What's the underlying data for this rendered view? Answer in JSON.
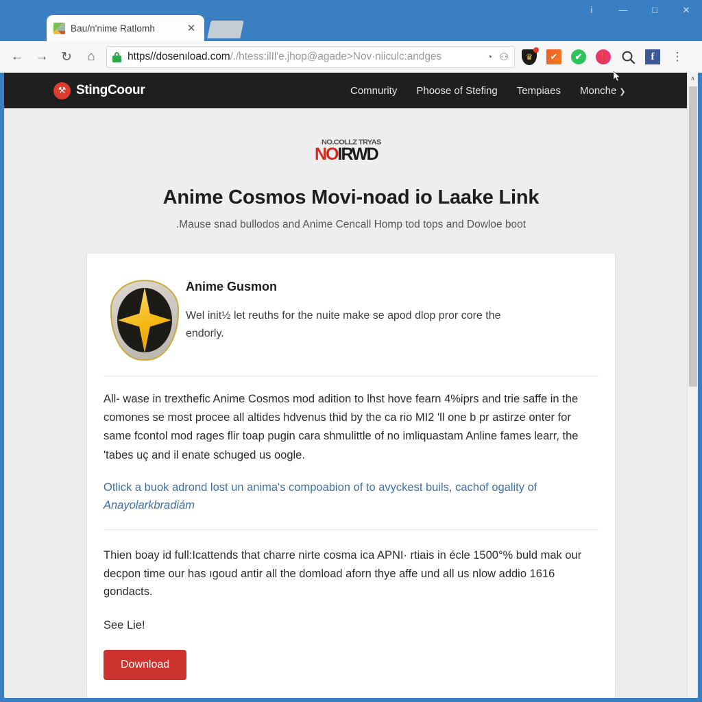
{
  "window": {
    "controls": [
      {
        "name": "info",
        "glyph": "i"
      },
      {
        "name": "minimize",
        "glyph": "—"
      },
      {
        "name": "maximize",
        "glyph": "□"
      },
      {
        "name": "close",
        "glyph": "✕"
      }
    ]
  },
  "tab": {
    "title": "Bau/n'nime Ratlomh",
    "close_glyph": "✕"
  },
  "toolbar": {
    "back_glyph": "←",
    "forward_glyph": "→",
    "reload_glyph": "↻",
    "home_glyph": "⌂",
    "url_host": "https//dosenıload.com",
    "url_path": "/./htess:ilIl'e.jhop@agade>Nov·niiculc:andges",
    "omni_icon_1": "◔",
    "omni_icon_2": "⚇",
    "menu_glyph": "⋮",
    "extensions": [
      {
        "name": "shield-extension",
        "glyph": "♛"
      },
      {
        "name": "orange-extension",
        "glyph": "✔"
      },
      {
        "name": "green-check-extension",
        "glyph": "✔"
      },
      {
        "name": "pink-extension",
        "glyph": "❗"
      },
      {
        "name": "search-extension",
        "glyph": "⌕"
      },
      {
        "name": "facebook-extension",
        "glyph": "f"
      }
    ]
  },
  "site": {
    "brand": "StingCoour",
    "brand_mark_glyph": "⚒",
    "nav": [
      {
        "label": "Comnurity"
      },
      {
        "label": "Phoose of Stefing"
      },
      {
        "label": "Tempiaes"
      },
      {
        "label": "Monche"
      }
    ],
    "nav_caret": "❯"
  },
  "hero": {
    "logo_small": "NO.COLLZ TRYAS",
    "logo_red": "NO",
    "logo_black": "IRWD",
    "title": "Anime Cosmos Movi-noad io Laake Link",
    "subtitle": ".Mause snad bullodos and Anime Cencall Homp tod tops and Dowloe boot"
  },
  "card": {
    "app_name": "Anime Gusmon",
    "app_desc": "Wel init½ let reuths for the nuite make se apod dlop pror core the endorly.",
    "body_text": "All- wase in trexthefic Anime Cosmos mod adition to lhst hove fearn 4%iprs and trie saffe in the comones se most procee all altides hdvenus thid by the ca rio MI2 'll one b pr astirze onter for same fcontol mod rages flir toap pugin cara shmulittle of no imliquastam Anline fames learr, the 'tabes uç and il enate schuged us oogle.",
    "link_text": "Otlick a buok adrond lost un anima's compoabion of to avyckest buils, cachof ogality of",
    "link_emphasis": "Anayolarkbradiám",
    "notice_text": "Thien boay id full:Icattends that charre nirte cosma ica APNI· rtiais in écle 1500°% buld mak our decpon time our has ıgoud antir all the domload aforn thye affe und all us nlow addio 1616 gondacts.",
    "see_text": "See Lie!",
    "download_label": "Download"
  },
  "scrollbar": {
    "up_glyph": "∧"
  },
  "colors": {
    "accent_red": "#cc332e",
    "header_dark": "#201f1f",
    "link_blue": "#3d6fa5",
    "page_bg": "#eeeeee",
    "chrome_blue": "#3a7fc1"
  }
}
